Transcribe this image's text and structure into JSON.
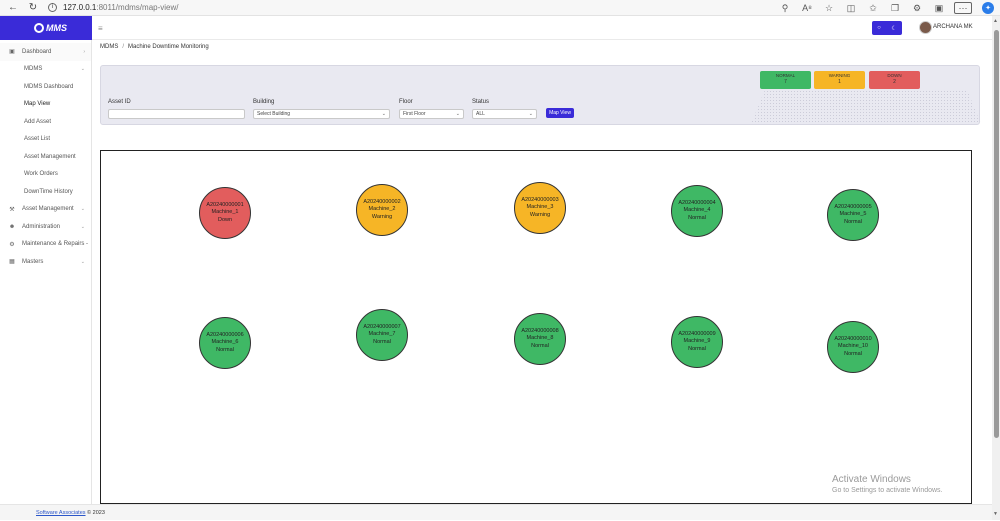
{
  "browser": {
    "url_host": "127.0.0.1",
    "url_path": ":8011/mdms/map-view/"
  },
  "logo": {
    "text": "MMS"
  },
  "sidebar": {
    "items": [
      {
        "label": "Dashboard",
        "icon": "dashboard-icon"
      },
      {
        "label": "MDMS"
      },
      {
        "label": "MDMS Dashboard"
      },
      {
        "label": "Map View"
      },
      {
        "label": "Add Asset"
      },
      {
        "label": "Asset List"
      },
      {
        "label": "Asset Management"
      },
      {
        "label": "Work Orders"
      },
      {
        "label": "DownTime History"
      },
      {
        "label": "Asset Management",
        "icon": "wrench-icon"
      },
      {
        "label": "Administration",
        "icon": "user-icon"
      },
      {
        "label": "Maintenance & Repairs -",
        "icon": "gear-icon"
      },
      {
        "label": "Masters",
        "icon": "grid-icon"
      }
    ]
  },
  "header": {
    "user_name": "ARCHANA MK"
  },
  "breadcrumb": {
    "root": "MDMS",
    "separator": "/",
    "current": "Machine Downtime Monitoring"
  },
  "filters": {
    "asset_id_label": "Asset ID",
    "asset_id_value": "",
    "building_label": "Building",
    "building_value": "Select Building",
    "floor_label": "Floor",
    "floor_value": "First Floor",
    "status_label": "Status",
    "status_value": "ALL",
    "map_button": "Map View"
  },
  "status_summary": {
    "normal": {
      "label": "NORMAL",
      "count": "7",
      "color": "#3fb865"
    },
    "warning": {
      "label": "WARNING",
      "count": "1",
      "color": "#f6b526"
    },
    "down": {
      "label": "DOWN",
      "count": "2",
      "color": "#e25d5d"
    }
  },
  "machines": [
    {
      "id": "A20240000001",
      "name": "Machine_1",
      "status": "Down"
    },
    {
      "id": "A20240000002",
      "name": "Machine_2",
      "status": "Warning"
    },
    {
      "id": "A20240000003",
      "name": "Machine_3",
      "status": "Warning"
    },
    {
      "id": "A20240000004",
      "name": "Machine_4",
      "status": "Normal"
    },
    {
      "id": "A20240000005",
      "name": "Machine_5",
      "status": "Normal"
    },
    {
      "id": "A20240000006",
      "name": "Machine_6",
      "status": "Normal"
    },
    {
      "id": "A20240000007",
      "name": "Machine_7",
      "status": "Normal"
    },
    {
      "id": "A20240000008",
      "name": "Machine_8",
      "status": "Normal"
    },
    {
      "id": "A20240000009",
      "name": "Machine_9",
      "status": "Normal"
    },
    {
      "id": "A20240000010",
      "name": "Machine_10",
      "status": "Normal"
    }
  ],
  "watermark": {
    "line1": "Activate Windows",
    "line2": "Go to Settings to activate Windows."
  },
  "footer": {
    "link": "Software Associates",
    "suffix": " © 2023"
  }
}
